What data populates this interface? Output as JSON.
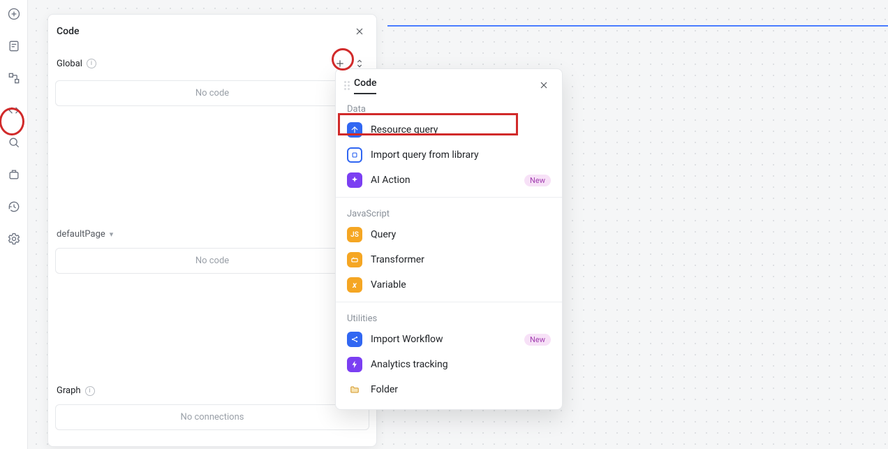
{
  "panel": {
    "title": "Code",
    "global_label": "Global",
    "no_code": "No code",
    "default_page": "defaultPage",
    "graph_label": "Graph",
    "no_connections": "No connections"
  },
  "popover": {
    "tab": "Code",
    "groups": {
      "data": "Data",
      "javascript": "JavaScript",
      "utilities": "Utilities"
    },
    "items": {
      "resource_query": "Resource query",
      "import_query": "Import query from library",
      "ai_action": "AI Action",
      "js_query": "Query",
      "transformer": "Transformer",
      "variable": "Variable",
      "import_workflow": "Import Workflow",
      "analytics": "Analytics tracking",
      "folder": "Folder"
    },
    "new_pill": "New"
  }
}
